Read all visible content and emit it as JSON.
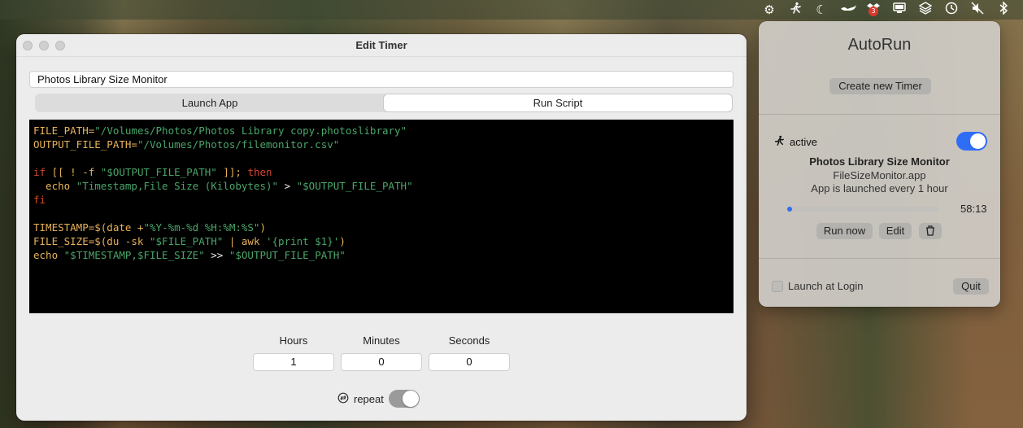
{
  "menubar": {
    "icons": [
      "gear-icon",
      "runner-icon",
      "moon-icon",
      "genie-lamp-icon",
      "dropbox-icon",
      "display-icon",
      "layers-icon",
      "clock-icon",
      "mute-icon",
      "bluetooth-icon"
    ],
    "badge": "3"
  },
  "edit_window": {
    "title": "Edit Timer",
    "name_value": "Photos Library Size Monitor",
    "tabs": [
      {
        "label": "Launch App",
        "active": false
      },
      {
        "label": "Run Script",
        "active": true
      }
    ],
    "script": {
      "line1_var": "FILE_PATH=",
      "line1_val": "\"/Volumes/Photos/Photos Library copy.photoslibrary\"",
      "line2_var": "OUTPUT_FILE_PATH=",
      "line2_val": "\"/Volumes/Photos/filemonitor.csv\"",
      "line4_if": "if",
      "line4_mid": " [[ ! -f ",
      "line4_str": "\"$OUTPUT_FILE_PATH\"",
      "line4_end": " ]]; ",
      "line4_then": "then",
      "line5_echo": "  echo ",
      "line5_str1": "\"Timestamp,File Size (Kilobytes)\"",
      "line5_gt": " > ",
      "line5_str2": "\"$OUTPUT_FILE_PATH\"",
      "line6_fi": "fi",
      "line8_var": "TIMESTAMP=$(date +",
      "line8_str": "\"%Y-%m-%d %H:%M:%S\"",
      "line8_end": ")",
      "line9_var": "FILE_SIZE=$(du -sk ",
      "line9_str": "\"$FILE_PATH\"",
      "line9_mid": " | awk ",
      "line9_str2": "'{print $1}'",
      "line9_end": ")",
      "line10_echo": "echo ",
      "line10_str": "\"$TIMESTAMP,$FILE_SIZE\"",
      "line10_mid": " >> ",
      "line10_str2": "\"$OUTPUT_FILE_PATH\""
    },
    "interval": {
      "hours_label": "Hours",
      "minutes_label": "Minutes",
      "seconds_label": "Seconds",
      "hours": "1",
      "minutes": "0",
      "seconds": "0"
    },
    "repeat_label": "repeat",
    "repeat_on": true
  },
  "autorun": {
    "title": "AutoRun",
    "create_button": "Create new Timer",
    "timer": {
      "status": "active",
      "enabled": true,
      "name": "Photos Library Size Monitor",
      "app": "FileSizeMonitor.app",
      "description": "App is launched every 1 hour",
      "progress": 0.03,
      "countdown": "58:13",
      "run_now": "Run now",
      "edit": "Edit"
    },
    "launch_at_login": "Launch at Login",
    "quit": "Quit"
  },
  "colors": {
    "accent": "#2f6df6",
    "keyword": "#e7b25a",
    "string": "#4aa56a",
    "control": "#d6452e"
  }
}
